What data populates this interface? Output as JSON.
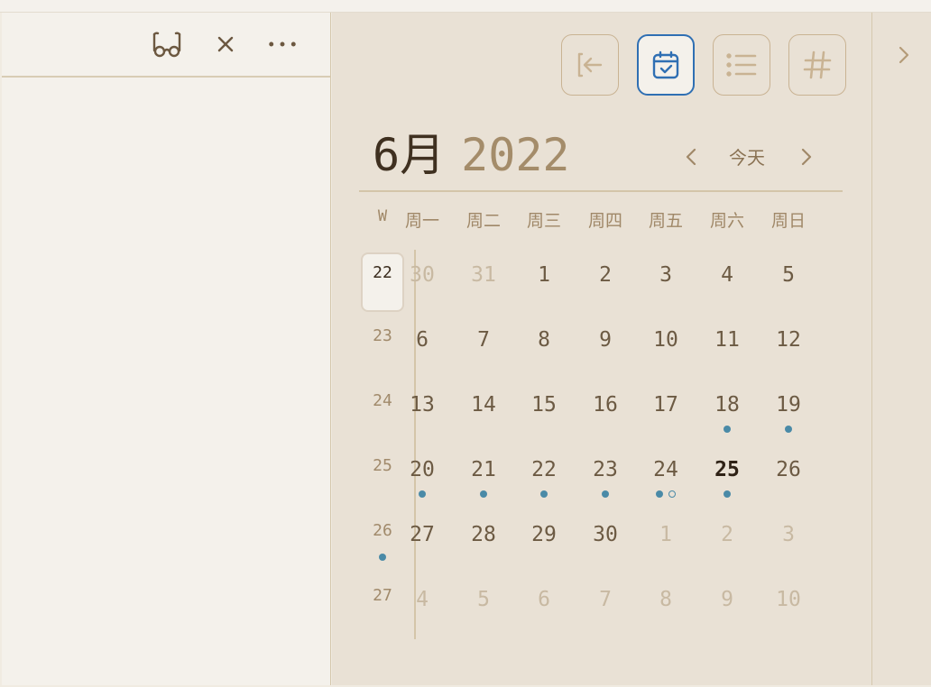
{
  "header": {
    "icons": [
      {
        "name": "reading-glasses-icon"
      },
      {
        "name": "close-icon"
      },
      {
        "name": "more-options-icon"
      }
    ]
  },
  "toolbar": {
    "buttons": [
      {
        "name": "back-to-note-button",
        "icon": "arrow-left-bracket-icon",
        "active": false
      },
      {
        "name": "calendar-view-button",
        "icon": "calendar-check-icon",
        "active": true
      },
      {
        "name": "list-view-button",
        "icon": "list-icon",
        "active": false
      },
      {
        "name": "tags-view-button",
        "icon": "hashtag-icon",
        "active": false
      }
    ],
    "accent": "#2f6fb3"
  },
  "calendar": {
    "month": "6月",
    "year": "2022",
    "today_label": "今天",
    "week_header": "W",
    "weekdays": [
      "周一",
      "周二",
      "周三",
      "周四",
      "周五",
      "周六",
      "周日"
    ],
    "weeks": [
      {
        "week": "22",
        "current": true,
        "days": [
          {
            "d": "30",
            "out": true
          },
          {
            "d": "31",
            "out": true
          },
          {
            "d": "1"
          },
          {
            "d": "2"
          },
          {
            "d": "3"
          },
          {
            "d": "4"
          },
          {
            "d": "5"
          }
        ]
      },
      {
        "week": "23",
        "days": [
          {
            "d": "6"
          },
          {
            "d": "7"
          },
          {
            "d": "8"
          },
          {
            "d": "9"
          },
          {
            "d": "10"
          },
          {
            "d": "11"
          },
          {
            "d": "12"
          }
        ]
      },
      {
        "week": "24",
        "days": [
          {
            "d": "13"
          },
          {
            "d": "14"
          },
          {
            "d": "15"
          },
          {
            "d": "16"
          },
          {
            "d": "17"
          },
          {
            "d": "18",
            "dots": [
              "filled"
            ]
          },
          {
            "d": "19",
            "dots": [
              "filled"
            ]
          }
        ]
      },
      {
        "week": "25",
        "days": [
          {
            "d": "20",
            "dots": [
              "filled"
            ]
          },
          {
            "d": "21",
            "dots": [
              "filled"
            ]
          },
          {
            "d": "22",
            "dots": [
              "filled"
            ]
          },
          {
            "d": "23",
            "dots": [
              "filled"
            ]
          },
          {
            "d": "24",
            "dots": [
              "filled",
              "hollow"
            ]
          },
          {
            "d": "25",
            "today": true,
            "dots": [
              "filled"
            ]
          },
          {
            "d": "26"
          }
        ]
      },
      {
        "week": "26",
        "week_dots": [
          "filled"
        ],
        "days": [
          {
            "d": "27"
          },
          {
            "d": "28"
          },
          {
            "d": "29"
          },
          {
            "d": "30"
          },
          {
            "d": "1",
            "out": true
          },
          {
            "d": "2",
            "out": true
          },
          {
            "d": "3",
            "out": true
          }
        ]
      },
      {
        "week": "27",
        "days": [
          {
            "d": "4",
            "out": true
          },
          {
            "d": "5",
            "out": true
          },
          {
            "d": "6",
            "out": true
          },
          {
            "d": "7",
            "out": true
          },
          {
            "d": "8",
            "out": true
          },
          {
            "d": "9",
            "out": true
          },
          {
            "d": "10",
            "out": true
          }
        ]
      }
    ]
  },
  "colors": {
    "dot": "#4a8aa7",
    "pane_bg": "#e9e1d5",
    "left_bg": "#f4f1eb"
  }
}
